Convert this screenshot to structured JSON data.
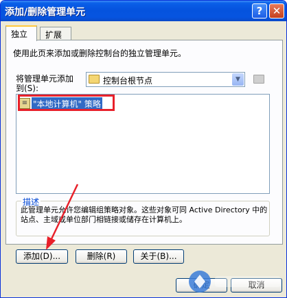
{
  "window": {
    "title": "添加/删除管理单元",
    "help_glyph": "?",
    "close_glyph": "✕"
  },
  "tabs": [
    {
      "label": "独立",
      "active": true
    },
    {
      "label": "扩展",
      "active": false
    }
  ],
  "main": {
    "description": "使用此页来添加或删除控制台的独立管理单元。",
    "add_to_label_line1": "将管理单元添加",
    "add_to_label_line2": "到(S):",
    "add_to_value": "控制台根节点",
    "snapins": [
      {
        "name": "\"本地计算机\" 策略",
        "selected": true
      }
    ]
  },
  "description_group": {
    "legend": "描述",
    "text": "此管理单元允许您编辑组策略对象。这些对象可同 Active Directory 中的站点、主域或单位部门相链接或储存在计算机上。"
  },
  "buttons": {
    "add": "添加(D)...",
    "remove": "删除(R)",
    "about": "关于(B)...",
    "ok": "确定",
    "cancel": "取消"
  },
  "colors": {
    "title_bar": "#0553de",
    "highlight": "#316ac5",
    "annotation_red": "#e8202a"
  },
  "icons": [
    "help-icon",
    "close-icon",
    "folder-icon",
    "dropdown-arrow-icon",
    "snapin-icon"
  ]
}
